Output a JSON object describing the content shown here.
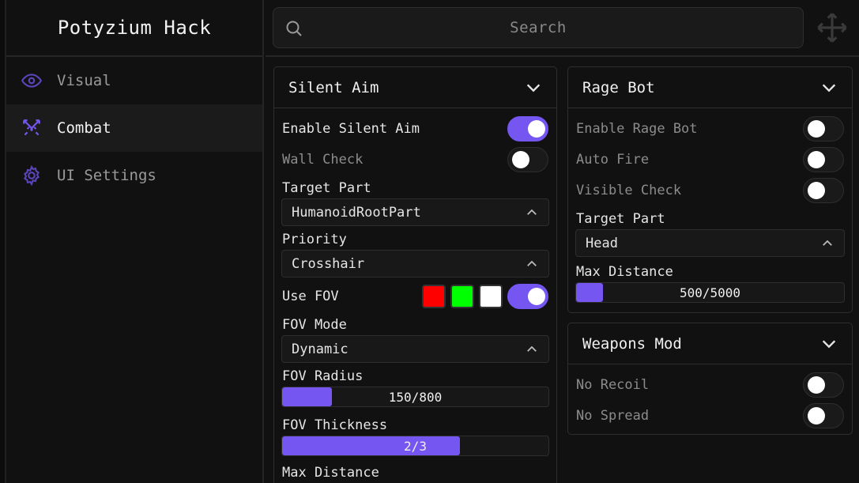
{
  "app": {
    "title": "Potyzium Hack"
  },
  "sidebar": {
    "items": [
      {
        "label": "Visual",
        "icon": "eye-icon"
      },
      {
        "label": "Combat",
        "icon": "crossed-swords-icon"
      },
      {
        "label": "UI Settings",
        "icon": "gear-icon"
      }
    ]
  },
  "search": {
    "placeholder": "Search"
  },
  "colors": {
    "accent": "#7656f0",
    "swatch_red": "#ff0000",
    "swatch_green": "#00ff00",
    "swatch_white": "#ffffff"
  },
  "silent_aim": {
    "title": "Silent Aim",
    "enable_label": "Enable Silent Aim",
    "enable_on": true,
    "wall_check_label": "Wall Check",
    "wall_check_on": false,
    "target_part_label": "Target Part",
    "target_part_value": "HumanoidRootPart",
    "priority_label": "Priority",
    "priority_value": "Crosshair",
    "use_fov_label": "Use FOV",
    "use_fov_on": true,
    "fov_mode_label": "FOV Mode",
    "fov_mode_value": "Dynamic",
    "fov_radius_label": "FOV Radius",
    "fov_radius_text": "150/800",
    "fov_radius_fraction": 0.1875,
    "fov_thickness_label": "FOV Thickness",
    "fov_thickness_text": "2/3",
    "fov_thickness_fraction": 0.667,
    "max_distance_label": "Max Distance"
  },
  "rage_bot": {
    "title": "Rage Bot",
    "enable_label": "Enable Rage Bot",
    "enable_on": false,
    "auto_fire_label": "Auto Fire",
    "auto_fire_on": false,
    "visible_check_label": "Visible Check",
    "visible_check_on": false,
    "target_part_label": "Target Part",
    "target_part_value": "Head",
    "max_distance_label": "Max Distance",
    "max_distance_text": "500/5000",
    "max_distance_fraction": 0.1
  },
  "weapons_mod": {
    "title": "Weapons Mod",
    "no_recoil_label": "No Recoil",
    "no_recoil_on": false,
    "no_spread_label": "No Spread",
    "no_spread_on": false
  }
}
